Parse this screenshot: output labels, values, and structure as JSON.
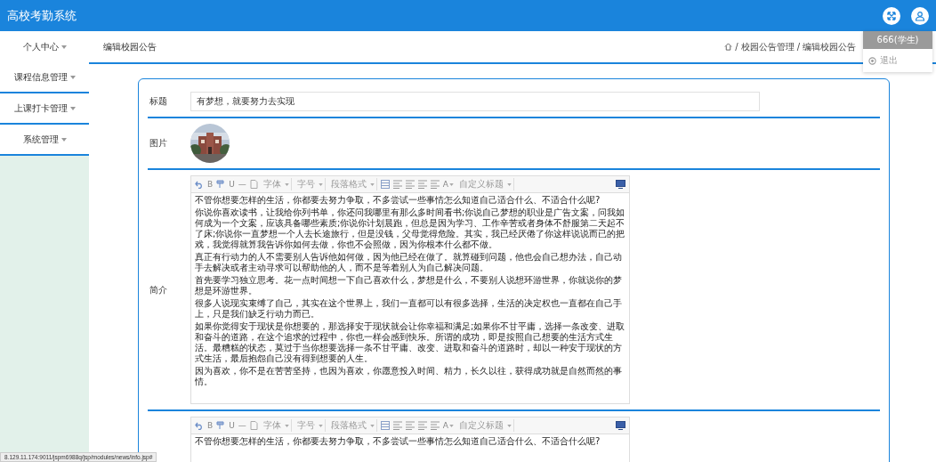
{
  "header": {
    "title": "高校考勤系统"
  },
  "user_menu": {
    "user": "666(学生)",
    "items": [
      "退出"
    ]
  },
  "sidebar": {
    "items": [
      {
        "label": "个人中心",
        "expanded": false
      },
      {
        "label": "课程信息管理",
        "expanded": false
      },
      {
        "label": "上课打卡管理",
        "expanded": false
      },
      {
        "label": "系统管理",
        "expanded": false
      }
    ]
  },
  "page_title": "编辑校园公告",
  "breadcrumb": {
    "separator": "/",
    "items": [
      "校园公告管理",
      "编辑校园公告"
    ]
  },
  "form": {
    "rows": [
      {
        "kind": "input",
        "label": "标题",
        "value": "有梦想，就要努力去实现"
      },
      {
        "label": "图片"
      },
      {
        "kind": "editor",
        "label": "简介",
        "toolbar": [
          {
            "kind": "undo"
          },
          {
            "kind": "glyph",
            "label": "B"
          },
          {
            "kind": "painter"
          },
          {
            "kind": "glyph",
            "label": "U"
          },
          {
            "kind": "glyph",
            "label": "—"
          },
          {
            "kind": "doc"
          },
          {
            "kind": "select",
            "label": "字体"
          },
          {
            "kind": "select",
            "label": "字号"
          },
          {
            "kind": "select",
            "label": "段落格式"
          },
          {
            "kind": "table"
          },
          {
            "kind": "align"
          },
          {
            "kind": "align"
          },
          {
            "kind": "align"
          },
          {
            "kind": "align"
          },
          {
            "kind": "color",
            "label": "A"
          },
          {
            "kind": "select",
            "label": "自定义标题"
          },
          {
            "kind": "preview"
          }
        ],
        "paragraphs": [
          "不管你想要怎样的生活，你都要去努力争取，不多尝试一些事情怎么知道自己适合什么、不适合什么呢?",
          "你说你喜欢读书，让我给你列书单，你还问我哪里有那么多时间看书;你说自己梦想的职业是广告文案，问我如何成为一个文案，应该具备哪些素质;你说你计划晨跑，但总是因为学习、工作辛苦或者身体不舒服第二天起不了床;你说你一直梦想一个人去长途旅行，但是没钱，父母觉得危险。其实，我已经厌倦了你这样说说而已的把戏，我觉得就算我告诉你如何去做，你也不会照做，因为你根本什么都不做。",
          "真正有行动力的人不需要别人告诉他如何做，因为他已经在做了。就算碰到问题，他也会自己想办法，自己动手去解决或者主动寻求可以帮助他的人，而不是等着别人为自己解决问题。",
          "首先要学习独立思考。花一点时间想一下自己喜欢什么，梦想是什么，不要别人说想环游世界，你就说你的梦想是环游世界。",
          "很多人说现实束缚了自己，其实在这个世界上，我们一直都可以有很多选择，生活的决定权也一直都在自己手上，只是我们缺乏行动力而已。",
          "如果你觉得安于现状是你想要的，那选择安于现状就会让你幸福和满足;如果你不甘平庸，选择一条改变、进取和奋斗的道路，在这个追求的过程中，你也一样会感到快乐。所谓的成功，即是按照自己想要的生活方式生活。最糟糕的状态，莫过于当你想要选择一条不甘平庸、改变、进取和奋斗的道路时，却以一种安于现状的方式生活，最后抱怨自己没有得到想要的人生。",
          "因为喜欢，你不是在苦苦坚持，也因为喜欢，你愿意投入时间、精力，长久以往，获得成功就是自然而然的事情。"
        ]
      },
      {
        "kind": "editor",
        "toolbar": [
          {
            "kind": "undo"
          },
          {
            "kind": "glyph",
            "label": "B"
          },
          {
            "kind": "painter"
          },
          {
            "kind": "glyph",
            "label": "U"
          },
          {
            "kind": "glyph",
            "label": "—"
          },
          {
            "kind": "doc"
          },
          {
            "kind": "select",
            "label": "字体"
          },
          {
            "kind": "select",
            "label": "字号"
          },
          {
            "kind": "select",
            "label": "段落格式"
          },
          {
            "kind": "table"
          },
          {
            "kind": "align"
          },
          {
            "kind": "align"
          },
          {
            "kind": "align"
          },
          {
            "kind": "align"
          },
          {
            "kind": "color",
            "label": "A"
          },
          {
            "kind": "select",
            "label": "自定义标题"
          },
          {
            "kind": "preview"
          }
        ],
        "paragraphs": [
          "不管你想要怎样的生活，你都要去努力争取，不多尝试一些事情怎么知道自己适合什么、不适合什么呢?"
        ]
      }
    ]
  },
  "status_bar": {
    "url": "8.129.11.174:9011/jspm6988q/jsp/modules/news/info.jsp#"
  }
}
